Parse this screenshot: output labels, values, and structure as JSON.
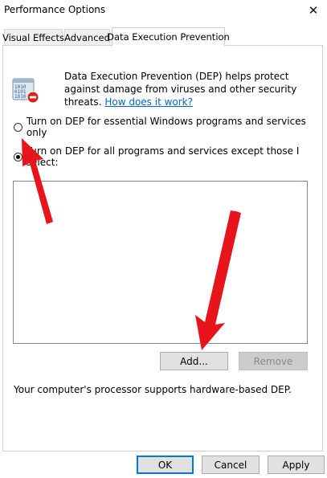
{
  "window": {
    "title": "Performance Options",
    "close_glyph": "✕"
  },
  "tabs": [
    {
      "label": "Visual Effects"
    },
    {
      "label": "Advanced"
    },
    {
      "label": "Data Execution Prevention",
      "active": true
    }
  ],
  "dep": {
    "description": "Data Execution Prevention (DEP) helps protect against damage from viruses and other security threats.",
    "link_text": "How does it work?",
    "icon": "shield-binary-icon"
  },
  "options": [
    {
      "label": "Turn on DEP for essential Windows programs and services only",
      "checked": false
    },
    {
      "label": "Turn on DEP for all programs and services except those I select:",
      "checked": true
    }
  ],
  "exceptions_list": {
    "items": []
  },
  "buttons": {
    "add": "Add...",
    "remove": "Remove",
    "ok": "OK",
    "cancel": "Cancel",
    "apply": "Apply"
  },
  "status_text": "Your computer's processor supports hardware-based DEP.",
  "colors": {
    "accent": "#0078d7",
    "link": "#0066cc",
    "annotation_arrow": "#e8141c"
  }
}
